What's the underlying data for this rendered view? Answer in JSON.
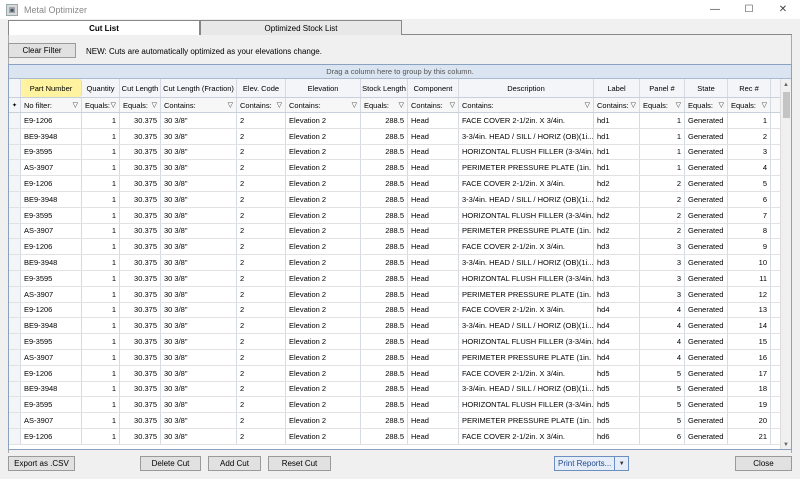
{
  "window": {
    "title": "Metal Optimizer",
    "minimize": "—",
    "maximize": "☐",
    "close": "✕"
  },
  "tabs": [
    {
      "label": "Cut List"
    },
    {
      "label": "Optimized Stock List"
    }
  ],
  "toolbar": {
    "clear_filter": "Clear Filter",
    "notice": "NEW: Cuts are automatically optimized as your elevations change."
  },
  "grid": {
    "group_hint": "Drag a column here to group by this column.",
    "columns": [
      "Part Number",
      "Quantity",
      "Cut Length",
      "Cut Length (Fraction)",
      "Elev. Code",
      "Elevation",
      "Stock Length",
      "Component",
      "Description",
      "Label",
      "Panel #",
      "State",
      "Rec #"
    ],
    "filters": [
      "No filter:",
      "Equals:",
      "Equals:",
      "Contains:",
      "Contains:",
      "Contains:",
      "Equals:",
      "Contains:",
      "Contains:",
      "Contains:",
      "Equals:",
      "Equals:",
      "Equals:"
    ],
    "rows": [
      [
        "E9-1206",
        "1",
        "30.375",
        "30 3/8\"",
        "2",
        "Elevation 2",
        "288.5",
        "Head",
        "FACE COVER  2-1/2in. X 3/4in.",
        "hd1",
        "1",
        "Generated",
        "1"
      ],
      [
        "BE9-3948",
        "1",
        "30.375",
        "30 3/8\"",
        "2",
        "Elevation 2",
        "288.5",
        "Head",
        "3-3/4in. HEAD / SILL / HORIZ (OB)(1i...",
        "hd1",
        "1",
        "Generated",
        "2"
      ],
      [
        "E9-3595",
        "1",
        "30.375",
        "30 3/8\"",
        "2",
        "Elevation 2",
        "288.5",
        "Head",
        "HORIZONTAL  FLUSH  FILLER  (3-3/4in...",
        "hd1",
        "1",
        "Generated",
        "3"
      ],
      [
        "AS-3907",
        "1",
        "30.375",
        "30 3/8\"",
        "2",
        "Elevation 2",
        "288.5",
        "Head",
        "PERIMETER PRESSURE PLATE (1in. GL)",
        "hd1",
        "1",
        "Generated",
        "4"
      ],
      [
        "E9-1206",
        "1",
        "30.375",
        "30 3/8\"",
        "2",
        "Elevation 2",
        "288.5",
        "Head",
        "FACE COVER  2-1/2in. X 3/4in.",
        "hd2",
        "2",
        "Generated",
        "5"
      ],
      [
        "BE9-3948",
        "1",
        "30.375",
        "30 3/8\"",
        "2",
        "Elevation 2",
        "288.5",
        "Head",
        "3-3/4in. HEAD / SILL / HORIZ (OB)(1i...",
        "hd2",
        "2",
        "Generated",
        "6"
      ],
      [
        "E9-3595",
        "1",
        "30.375",
        "30 3/8\"",
        "2",
        "Elevation 2",
        "288.5",
        "Head",
        "HORIZONTAL  FLUSH  FILLER  (3-3/4in...",
        "hd2",
        "2",
        "Generated",
        "7"
      ],
      [
        "AS-3907",
        "1",
        "30.375",
        "30 3/8\"",
        "2",
        "Elevation 2",
        "288.5",
        "Head",
        "PERIMETER PRESSURE PLATE (1in. GL)",
        "hd2",
        "2",
        "Generated",
        "8"
      ],
      [
        "E9-1206",
        "1",
        "30.375",
        "30 3/8\"",
        "2",
        "Elevation 2",
        "288.5",
        "Head",
        "FACE COVER  2-1/2in. X 3/4in.",
        "hd3",
        "3",
        "Generated",
        "9"
      ],
      [
        "BE9-3948",
        "1",
        "30.375",
        "30 3/8\"",
        "2",
        "Elevation 2",
        "288.5",
        "Head",
        "3-3/4in. HEAD / SILL / HORIZ (OB)(1i...",
        "hd3",
        "3",
        "Generated",
        "10"
      ],
      [
        "E9-3595",
        "1",
        "30.375",
        "30 3/8\"",
        "2",
        "Elevation 2",
        "288.5",
        "Head",
        "HORIZONTAL  FLUSH  FILLER  (3-3/4in...",
        "hd3",
        "3",
        "Generated",
        "11"
      ],
      [
        "AS-3907",
        "1",
        "30.375",
        "30 3/8\"",
        "2",
        "Elevation 2",
        "288.5",
        "Head",
        "PERIMETER PRESSURE PLATE (1in. GL)",
        "hd3",
        "3",
        "Generated",
        "12"
      ],
      [
        "E9-1206",
        "1",
        "30.375",
        "30 3/8\"",
        "2",
        "Elevation 2",
        "288.5",
        "Head",
        "FACE COVER  2-1/2in. X 3/4in.",
        "hd4",
        "4",
        "Generated",
        "13"
      ],
      [
        "BE9-3948",
        "1",
        "30.375",
        "30 3/8\"",
        "2",
        "Elevation 2",
        "288.5",
        "Head",
        "3-3/4in. HEAD / SILL / HORIZ (OB)(1i...",
        "hd4",
        "4",
        "Generated",
        "14"
      ],
      [
        "E9-3595",
        "1",
        "30.375",
        "30 3/8\"",
        "2",
        "Elevation 2",
        "288.5",
        "Head",
        "HORIZONTAL  FLUSH  FILLER  (3-3/4in...",
        "hd4",
        "4",
        "Generated",
        "15"
      ],
      [
        "AS-3907",
        "1",
        "30.375",
        "30 3/8\"",
        "2",
        "Elevation 2",
        "288.5",
        "Head",
        "PERIMETER PRESSURE PLATE (1in. GL)",
        "hd4",
        "4",
        "Generated",
        "16"
      ],
      [
        "E9-1206",
        "1",
        "30.375",
        "30 3/8\"",
        "2",
        "Elevation 2",
        "288.5",
        "Head",
        "FACE COVER  2-1/2in. X 3/4in.",
        "hd5",
        "5",
        "Generated",
        "17"
      ],
      [
        "BE9-3948",
        "1",
        "30.375",
        "30 3/8\"",
        "2",
        "Elevation 2",
        "288.5",
        "Head",
        "3-3/4in. HEAD / SILL / HORIZ (OB)(1i...",
        "hd5",
        "5",
        "Generated",
        "18"
      ],
      [
        "E9-3595",
        "1",
        "30.375",
        "30 3/8\"",
        "2",
        "Elevation 2",
        "288.5",
        "Head",
        "HORIZONTAL  FLUSH  FILLER  (3-3/4in...",
        "hd5",
        "5",
        "Generated",
        "19"
      ],
      [
        "AS-3907",
        "1",
        "30.375",
        "30 3/8\"",
        "2",
        "Elevation 2",
        "288.5",
        "Head",
        "PERIMETER PRESSURE PLATE (1in. GL)",
        "hd5",
        "5",
        "Generated",
        "20"
      ],
      [
        "E9-1206",
        "1",
        "30.375",
        "30 3/8\"",
        "2",
        "Elevation 2",
        "288.5",
        "Head",
        "FACE COVER  2-1/2in. X 3/4in.",
        "hd6",
        "6",
        "Generated",
        "21"
      ]
    ]
  },
  "footer": {
    "export_csv": "Export as .CSV",
    "delete_cut": "Delete Cut",
    "add_cut": "Add Cut",
    "reset_cut": "Reset Cut",
    "print_reports": "Print Reports...",
    "close": "Close"
  }
}
